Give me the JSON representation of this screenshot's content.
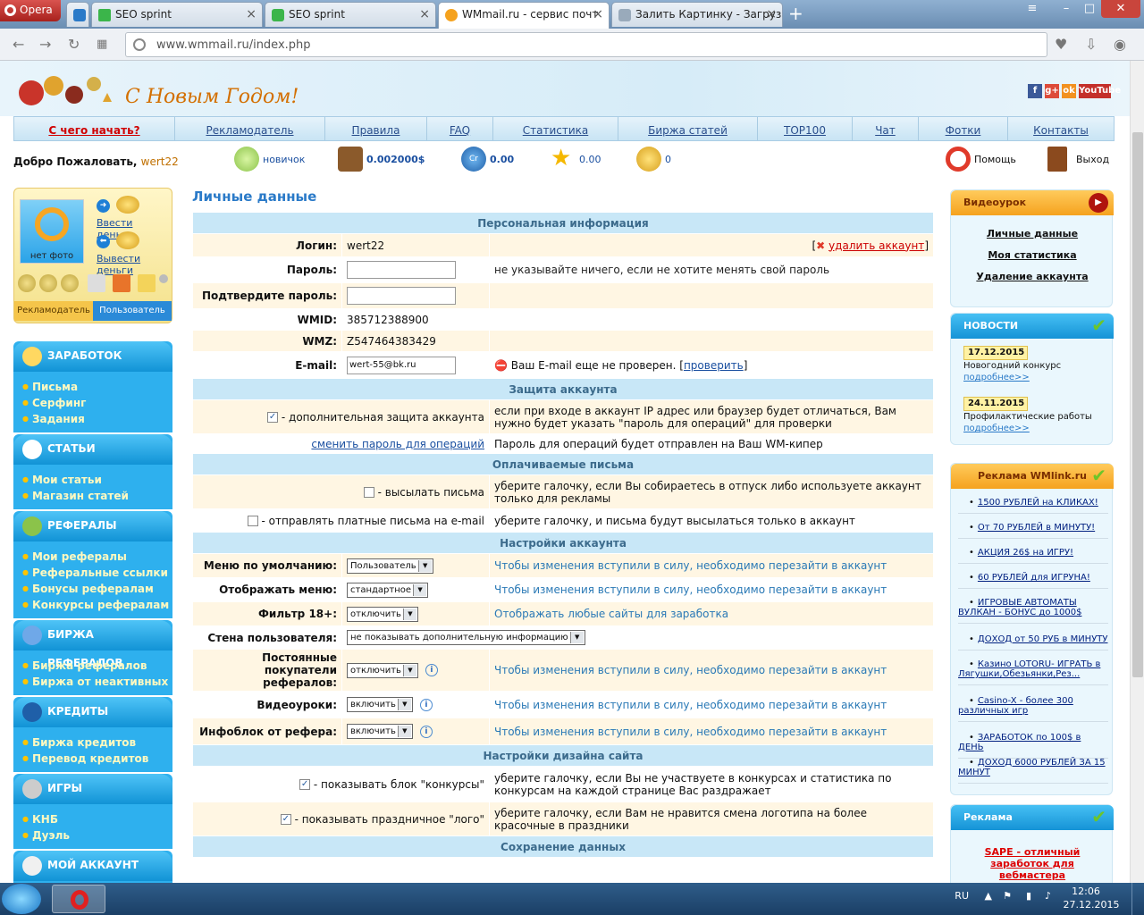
{
  "browser": {
    "menu_label": "Opera",
    "tabs": [
      {
        "title": "",
        "active": false
      },
      {
        "title": "SEO sprint",
        "active": false
      },
      {
        "title": "SEO sprint",
        "active": false
      },
      {
        "title": "WMmail.ru - сервис почт",
        "active": true
      },
      {
        "title": "Залить Картинку - Загруз",
        "active": false
      }
    ],
    "url": "www.wmmail.ru/index.php"
  },
  "banner": {
    "greeting": "С Новым Годом!",
    "social": [
      "f",
      "g+",
      "ok",
      "YouTube"
    ]
  },
  "menu": [
    "С чего начать?",
    "Рекламодатель",
    "Правила",
    "FAQ",
    "Статистика",
    "Биржа статей",
    "TOP100",
    "Чат",
    "Фотки",
    "Контакты"
  ],
  "welcome": {
    "label": "Добро Пожаловать,",
    "user": "wert22"
  },
  "stats": {
    "level": "новичок",
    "balance": "0.002000$",
    "credits": "0.00",
    "rating": "0.00",
    "coins": "0",
    "help": "Помощь",
    "logout": "Выход"
  },
  "profile": {
    "no_photo": "нет фото",
    "deposit": "Ввести деньги",
    "withdraw": "Вывести деньги",
    "tab_adv": "Рекламодатель",
    "tab_user": "Пользователь"
  },
  "sidebar": [
    {
      "title": "ЗАРАБОТОК",
      "items": [
        "Письма",
        "Серфинг",
        "Задания"
      ]
    },
    {
      "title": "СТАТЬИ",
      "items": [
        "Мои статьи",
        "Магазин статей"
      ]
    },
    {
      "title": "РЕФЕРАЛЫ",
      "items": [
        "Мои рефералы",
        "Реферальные ссылки",
        "Бонусы рефералам",
        "Конкурсы рефералам"
      ]
    },
    {
      "title": "БИРЖА РЕФЕРАЛОВ",
      "items": [
        "Биржа рефералов",
        "Биржа от неактивных"
      ]
    },
    {
      "title": "КРЕДИТЫ",
      "items": [
        "Биржа кредитов",
        "Перевод кредитов"
      ]
    },
    {
      "title": "ИГРЫ",
      "items": [
        "КНБ",
        "Дуэль"
      ]
    },
    {
      "title": "МОЙ АККАУНТ",
      "items": []
    }
  ],
  "main": {
    "title": "Личные данные",
    "sections": {
      "personal": "Персональная информация",
      "protection": "Защита аккаунта",
      "paid_mail": "Оплачиваемые письма",
      "settings": "Настройки аккаунта",
      "design": "Настройки дизайна сайта",
      "save": "Сохранение данных"
    },
    "login_label": "Логин:",
    "login_value": "wert22",
    "delete_account": "удалить аккаунт",
    "password_label": "Пароль:",
    "password_note": "не указывайте ничего, если не хотите менять свой пароль",
    "confirm_label": "Подтвердите пароль:",
    "wmid_label": "WMID:",
    "wmid_value": "385712388900",
    "wmz_label": "WMZ:",
    "wmz_value": "Z547464383429",
    "email_label": "E-mail:",
    "email_value": "wert-55@bk.ru",
    "email_note": "Ваш E-mail еще не проверен.",
    "email_check": "проверить",
    "extra_protection": "- дополнительная защита аккаунта",
    "extra_protection_note": "если при входе в аккаунт IP адрес или браузер будет отличаться, Вам нужно будет указать \"пароль для операций\" для проверки",
    "change_op_password": "сменить пароль для операций",
    "op_password_note": "Пароль для операций будет отправлен на Ваш WM-кипер",
    "send_mail": "- высылать письма",
    "send_mail_note": "уберите галочку, если Вы собираетесь в отпуск либо используете аккаунт только для рекламы",
    "send_paid_mail": "- отправлять платные письма на e-mail",
    "send_paid_mail_note": "уберите галочку, и письма будут высылаться только в аккаунт",
    "default_menu_label": "Меню по умолчанию:",
    "default_menu_value": "Пользователь",
    "relogin_note": "Чтобы изменения вступили в силу, необходимо перезайти в аккаунт",
    "display_menu_label": "Отображать меню:",
    "display_menu_value": "стандартное",
    "filter_label": "Фильтр 18+:",
    "filter_value": "отключить",
    "filter_note": "Отображать любые сайты для заработка",
    "wall_label": "Стена пользователя:",
    "wall_value": "не показывать дополнительную информацию",
    "regular_buyers_label": "Постоянные покупатели рефералов:",
    "regular_buyers_value": "отключить",
    "videos_label": "Видеоуроки:",
    "videos_value": "включить",
    "infoblock_label": "Инфоблок от рефера:",
    "infoblock_value": "включить",
    "show_contests": "- показывать блок \"конкурсы\"",
    "show_contests_note": "уберите галочку, если Вы не участвуете в конкурсах и статистика по конкурсам на каждой странице Вас раздражает",
    "show_logo": "- показывать праздничное \"лого\"",
    "show_logo_note": "уберите галочку, если Вам не нравится смена логотипа на более красочные в праздники"
  },
  "right": {
    "video_title": "Видеоурок",
    "video_links": [
      "Личные данные",
      "Моя статистика",
      "Удаление аккаунта"
    ],
    "news_title": "НОВОСТИ",
    "news": [
      {
        "date": "17.12.2015",
        "text": "Новогодний конкурс",
        "more": "подробнее>>"
      },
      {
        "date": "24.11.2015",
        "text": "Профилактические работы",
        "more": "подробнее>>"
      }
    ],
    "wmlink_title": "Реклама WMlink.ru",
    "ads": [
      "1500 РУБЛЕЙ на КЛИКАХ!",
      "От 70 РУБЛЕЙ в МИНУТУ!",
      "АКЦИЯ 26$ на ИГРУ!",
      "60 РУБЛЕЙ для ИГРУНА!",
      "ИГРОВЫЕ АВТОМАТЫ ВУЛКАН - БОНУС до 1000$",
      "ДОХОД от 50 РУБ в МИНУТУ",
      "Казино LOTORU- ИГРАТЬ в Лягушки,Обезьянки,Рез...",
      "Casino-X - более 300 различных игр",
      "ЗАРАБОТОК по 100$ в ДЕНЬ",
      "ДОХОД 6000 РУБЛЕЙ ЗА 15 МИНУТ"
    ],
    "adv_title": "Реклама",
    "adv_text": "SAPE - отличный заработок для вебмастера"
  },
  "taskbar": {
    "lang": "RU",
    "time": "12:06",
    "date": "27.12.2015"
  },
  "colors": {
    "accent_blue": "#2eb0ee",
    "link": "#1a4fa0",
    "orange": "#f5a21e",
    "section_bg": "#c8e7f7",
    "row_bg": "#fff6e3"
  }
}
